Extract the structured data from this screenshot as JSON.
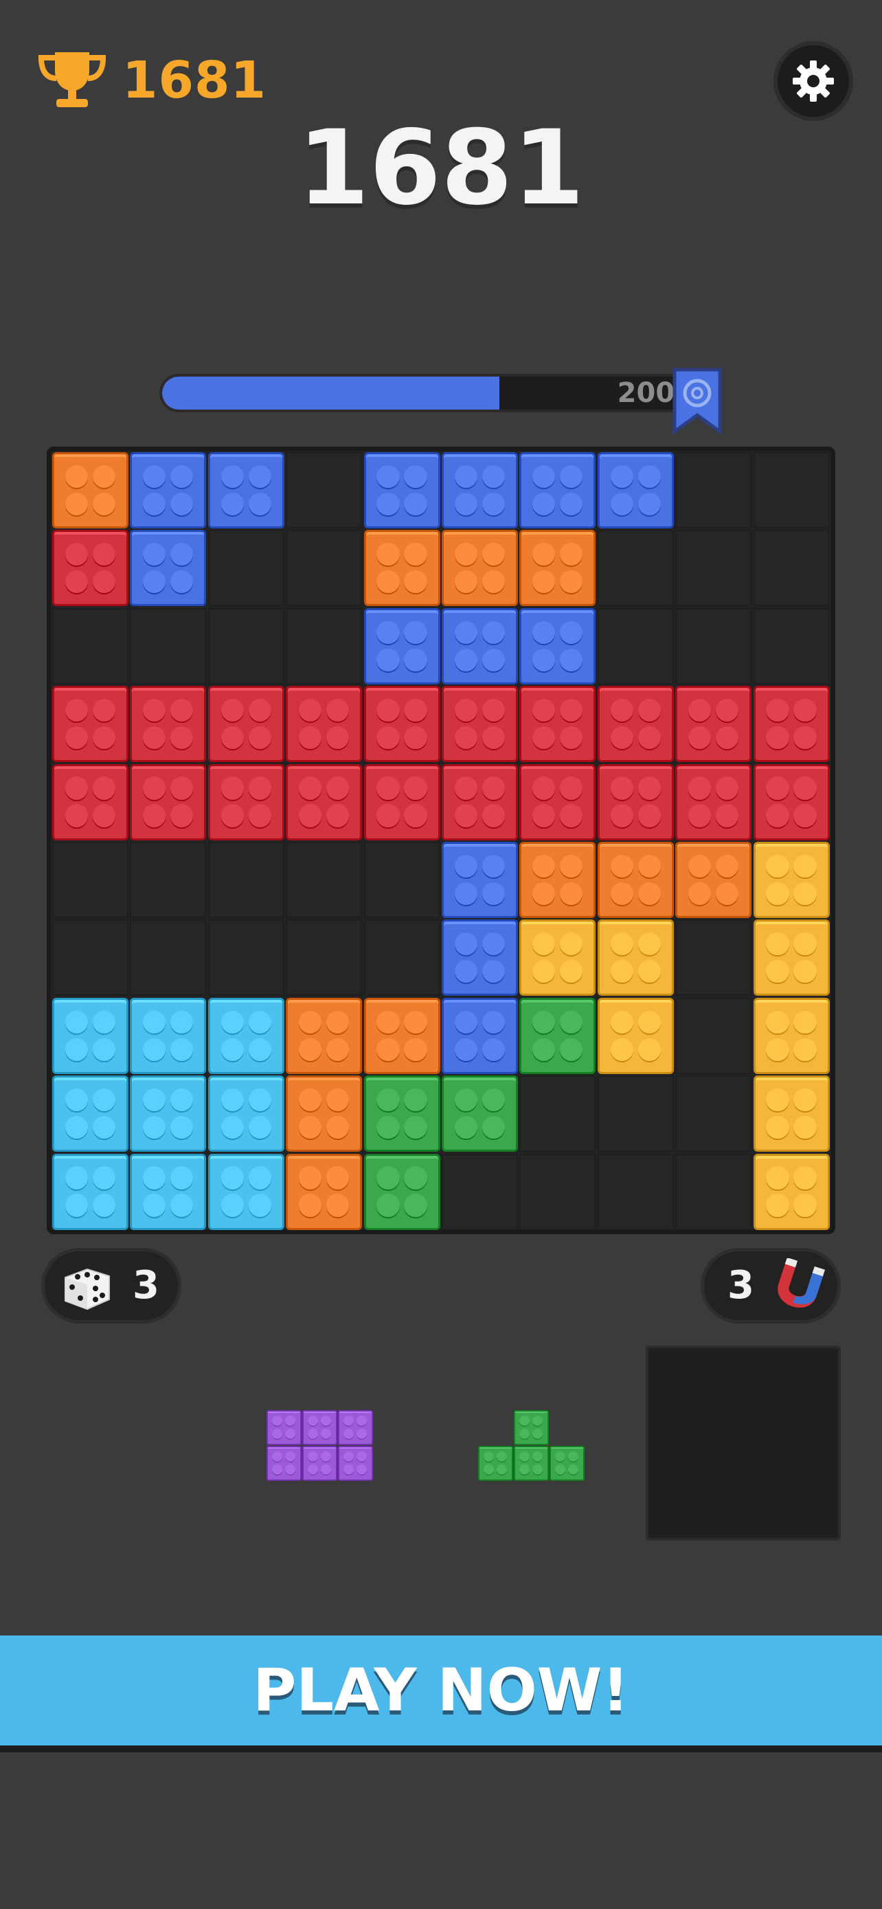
{
  "header": {
    "best_score": "1681",
    "current_score": "1681"
  },
  "progress": {
    "target": "2000",
    "fraction": 0.62
  },
  "colors": {
    "orange": "#ef7d2e",
    "blue": "#4b72e2",
    "red": "#d1333f",
    "yellow": "#f4b73b",
    "light_blue": "#4cc1ee",
    "green": "#3aa84b",
    "purple": "#9b5bd6",
    "empty": "#262626",
    "trophy": "#f7a72a",
    "banner": "#4cb9ea"
  },
  "board": {
    "rows": 10,
    "cols": 10,
    "grid": [
      [
        "orange",
        "blue",
        "blue",
        "",
        "blue",
        "blue",
        "blue",
        "blue",
        "",
        ""
      ],
      [
        "red",
        "blue",
        "",
        "",
        "orange",
        "orange",
        "orange",
        "",
        "",
        ""
      ],
      [
        "",
        "",
        "",
        "",
        "blue",
        "blue",
        "blue",
        "",
        "",
        ""
      ],
      [
        "red",
        "red",
        "red",
        "red",
        "red",
        "red",
        "red",
        "red",
        "red",
        "red"
      ],
      [
        "red",
        "red",
        "red",
        "red",
        "red",
        "red",
        "red",
        "red",
        "red",
        "red"
      ],
      [
        "",
        "",
        "",
        "",
        "",
        "blue",
        "orange",
        "orange",
        "orange",
        "yellow"
      ],
      [
        "",
        "",
        "",
        "",
        "",
        "blue",
        "yellow",
        "yellow",
        "",
        "yellow"
      ],
      [
        "light_blue",
        "light_blue",
        "light_blue",
        "orange",
        "orange",
        "blue",
        "green",
        "yellow",
        "",
        "yellow"
      ],
      [
        "light_blue",
        "light_blue",
        "light_blue",
        "orange",
        "green",
        "green",
        "",
        "",
        "",
        "yellow"
      ],
      [
        "light_blue",
        "light_blue",
        "light_blue",
        "orange",
        "green",
        "",
        "",
        "",
        "",
        "yellow"
      ]
    ]
  },
  "powerups": {
    "dice": {
      "icon": "dice-icon",
      "count": "3"
    },
    "magnet": {
      "icon": "magnet-icon",
      "count": "3"
    }
  },
  "pieces": [
    {
      "color": "purple",
      "cells": [
        [
          0,
          0
        ],
        [
          0,
          1
        ],
        [
          0,
          2
        ],
        [
          1,
          0
        ],
        [
          1,
          1
        ],
        [
          1,
          2
        ]
      ]
    },
    {
      "color": "green",
      "cells": [
        [
          0,
          1
        ],
        [
          1,
          0
        ],
        [
          1,
          1
        ],
        [
          1,
          2
        ]
      ]
    }
  ],
  "icons": {
    "trophy": "trophy-icon",
    "settings": "gear-icon",
    "level": "bookmark-ribbon-icon"
  },
  "cta": {
    "label": "PLAY NOW!"
  }
}
